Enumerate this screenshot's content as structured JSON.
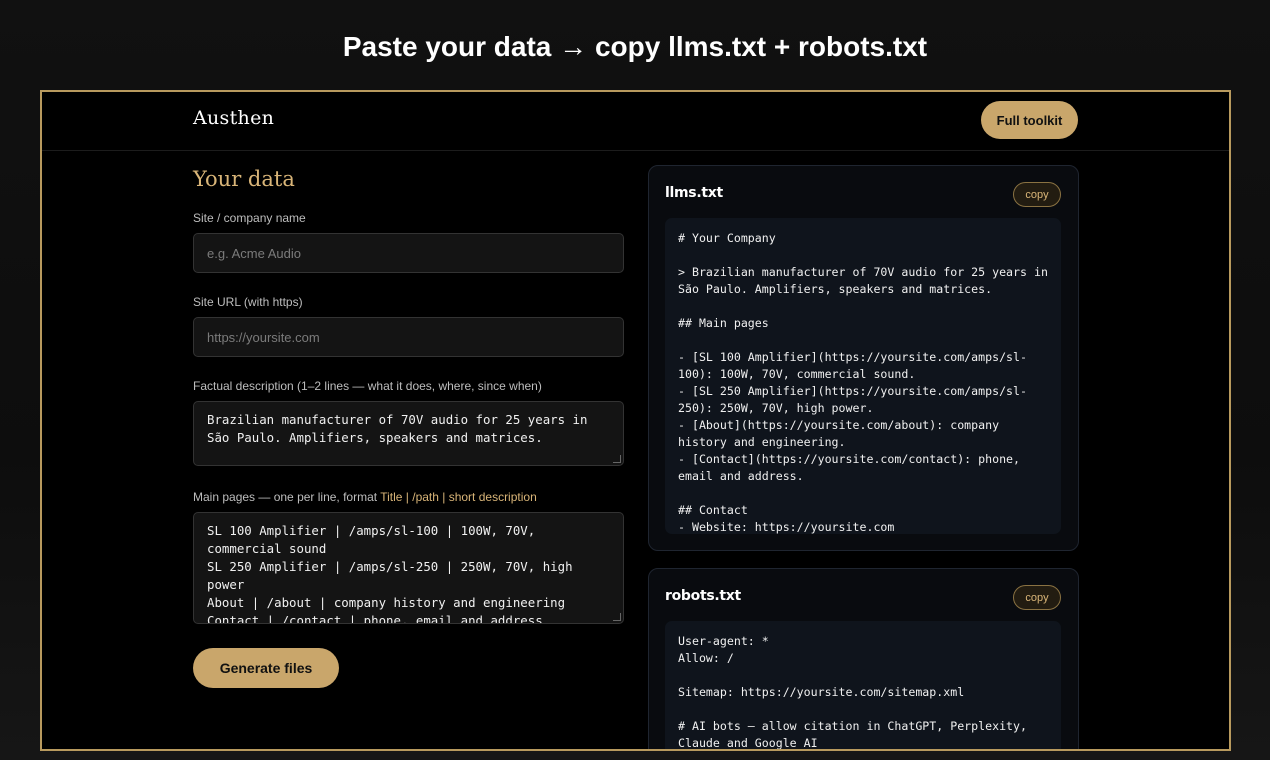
{
  "banner": "Paste your data → copy llms.txt + robots.txt",
  "header": {
    "brand": "Austhen",
    "toolkit_label": "Full toolkit"
  },
  "form": {
    "title": "Your data",
    "name_label": "Site / company name",
    "name_placeholder": "e.g. Acme Audio",
    "url_label": "Site URL (with https)",
    "url_placeholder": "https://yoursite.com",
    "desc_label": "Factual description (1–2 lines — what it does, where, since when)",
    "desc_value": "Brazilian manufacturer of 70V audio for 25 years in São Paulo. Amplifiers, speakers and matrices.",
    "pages_label_prefix": "Main pages — one per line, format ",
    "pages_label_format": "Title | /path | short description",
    "pages_value": "SL 100 Amplifier | /amps/sl-100 | 100W, 70V, commercial sound\nSL 250 Amplifier | /amps/sl-250 | 250W, 70V, high power\nAbout | /about | company history and engineering\nContact | /contact | phone, email and address",
    "generate_label": "Generate files"
  },
  "llms": {
    "title": "llms.txt",
    "copy_label": "copy",
    "content": "# Your Company\n\n> Brazilian manufacturer of 70V audio for 25 years in São Paulo. Amplifiers, speakers and matrices.\n\n## Main pages\n\n- [SL 100 Amplifier](https://yoursite.com/amps/sl-100): 100W, 70V, commercial sound.\n- [SL 250 Amplifier](https://yoursite.com/amps/sl-250): 250W, 70V, high power.\n- [About](https://yoursite.com/about): company history and engineering.\n- [Contact](https://yoursite.com/contact): phone, email and address.\n\n## Contact\n- Website: https://yoursite.com"
  },
  "robots": {
    "title": "robots.txt",
    "copy_label": "copy",
    "content": "User-agent: *\nAllow: /\n\nSitemap: https://yoursite.com/sitemap.xml\n\n# AI bots — allow citation in ChatGPT, Perplexity, Claude and Google AI\nUser-agent: GPTBot"
  }
}
